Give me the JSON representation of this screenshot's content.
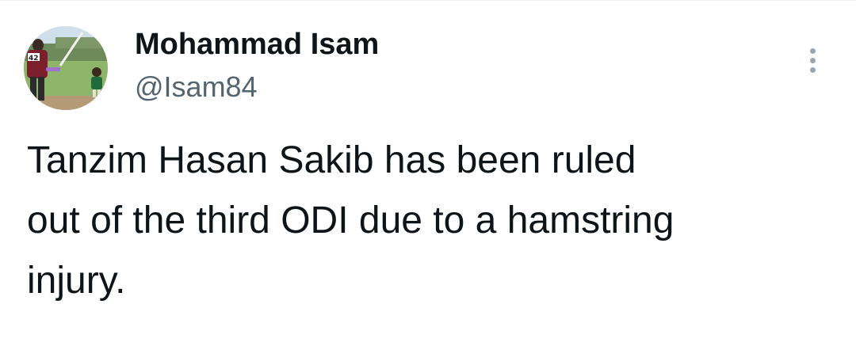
{
  "tweet": {
    "author": {
      "display_name": "Mohammad Isam",
      "handle": "@Isam84",
      "avatar_icon": "profile-photo-cricket",
      "avatar_jersey_number": "42"
    },
    "more_icon": "more-vertical-icon",
    "text_lines": [
      "Tanzim Hasan Sakib has been ruled",
      "out of the third ODI due to a hamstring",
      "injury."
    ]
  },
  "colors": {
    "text_primary": "#0f1419",
    "text_secondary": "#536471",
    "icon_muted": "#9aa6b0",
    "background": "#ffffff"
  }
}
